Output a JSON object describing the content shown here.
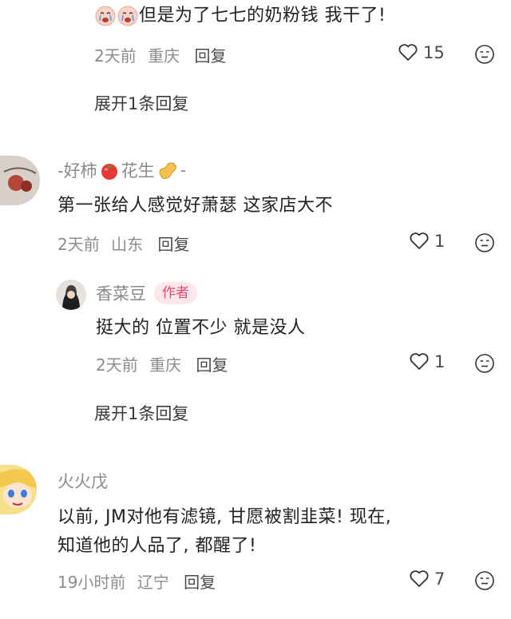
{
  "comments": [
    {
      "text": "但是为了七七的奶粉钱 我干了!",
      "time": "2天前",
      "location": "重庆",
      "reply_label": "回复",
      "likes": "15",
      "expand_label": "展开1条回复"
    },
    {
      "name_prefix": "-好柿",
      "name_mid": "花生",
      "name_suffix": "-",
      "text": "第一张给人感觉好萧瑟 这家店大不",
      "time": "2天前",
      "location": "山东",
      "reply_label": "回复",
      "likes": "1",
      "reply": {
        "name": "香菜豆",
        "badge": "作者",
        "text": "挺大的 位置不少 就是没人",
        "time": "2天前",
        "location": "重庆",
        "reply_label": "回复",
        "likes": "1"
      },
      "expand_label": "展开1条回复"
    },
    {
      "name": "火火戊",
      "text_line1": "以前, JM对他有滤镜, 甘愿被割韭菜! 现在,",
      "text_line2": "知道他的人品了, 都醒了!",
      "time": "19小时前",
      "location": "辽宁",
      "reply_label": "回复",
      "likes": "7"
    }
  ],
  "icons": {
    "like": "heart-outline-icon",
    "react": "neutral-face-icon",
    "emoji_crying": "crying-face-emoji",
    "emoji_tomato": "tomato-emoji",
    "emoji_peanut": "peanut-emoji"
  },
  "colors": {
    "author_badge_text": "#e8466b",
    "author_badge_bg": "#fde7ec",
    "meta_gray": "#8c8c8c"
  }
}
